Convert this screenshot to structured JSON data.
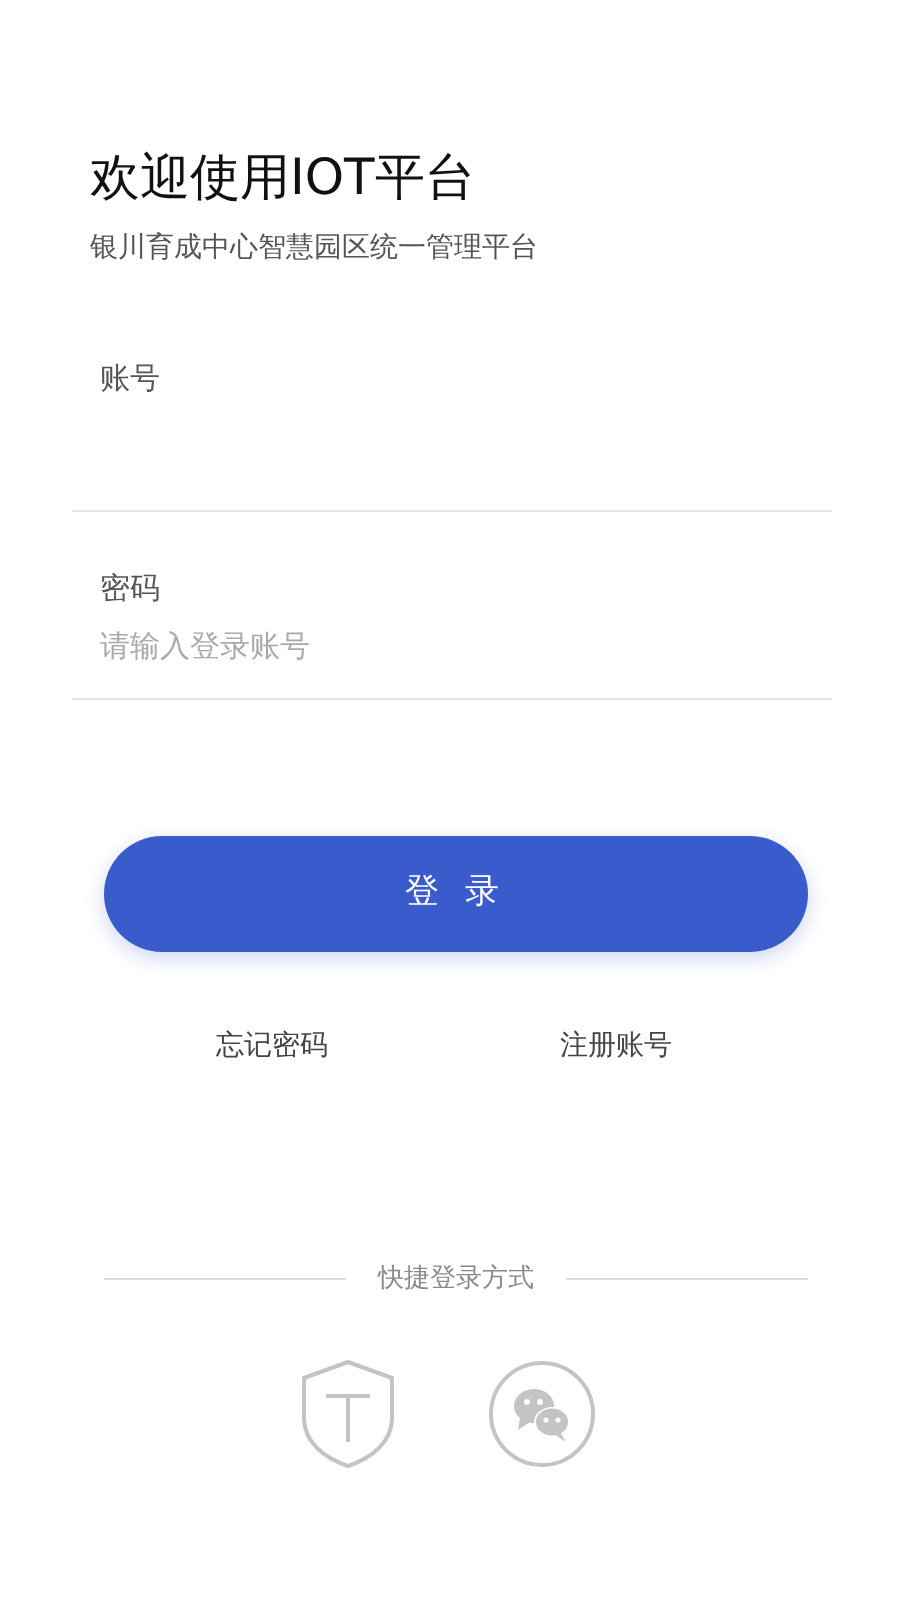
{
  "title": "欢迎使用IOT平台",
  "subtitle": "银川育成中心智慧园区统一管理平台",
  "fields": [
    {
      "label": "账号"
    },
    {
      "label": "密码",
      "placeholder": "请输入登录账号"
    }
  ],
  "login_button": "登 录",
  "links": [
    "忘记密码",
    "注册账号"
  ],
  "quick_login": {
    "label": "快捷登录方式",
    "options": [
      {
        "kind": "shield"
      },
      {
        "kind": "chat"
      }
    ]
  }
}
